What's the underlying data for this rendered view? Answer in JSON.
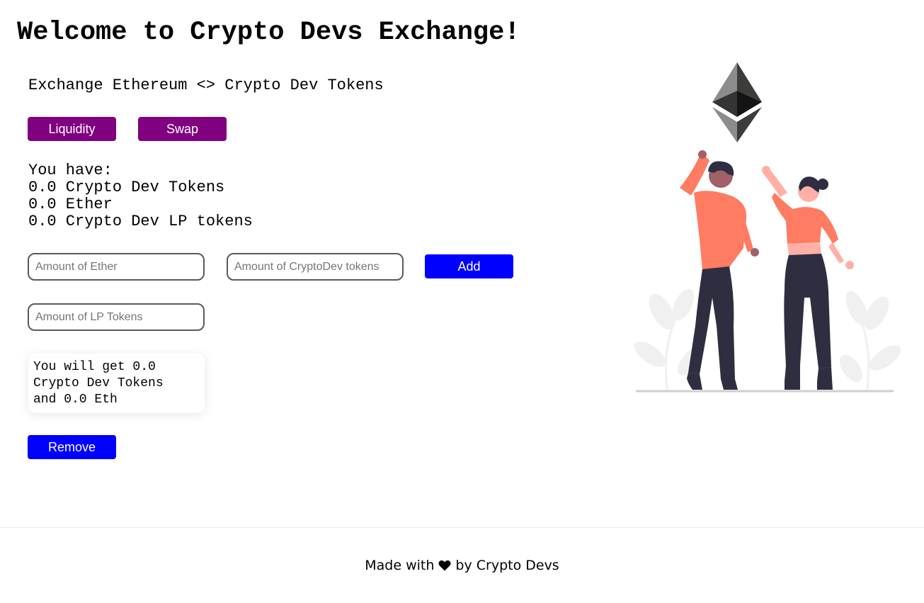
{
  "page": {
    "title": "Welcome to Crypto Devs Exchange!",
    "description": "Exchange Ethereum <> Crypto Dev Tokens"
  },
  "tabs": {
    "liquidity_label": "Liquidity",
    "swap_label": "Swap"
  },
  "balances": {
    "heading": "You have:",
    "crypto_dev_tokens": "0.0 Crypto Dev Tokens",
    "ether": "0.0 Ether",
    "lp_tokens": "0.0 Crypto Dev LP tokens"
  },
  "add_liquidity": {
    "ether_placeholder": "Amount of Ether",
    "ether_value": "",
    "cd_placeholder": "Amount of CryptoDev tokens",
    "cd_value": "",
    "add_label": "Add"
  },
  "remove_liquidity": {
    "lp_placeholder": "Amount of LP Tokens",
    "lp_value": "",
    "result_line1": "You will get 0.0",
    "result_line2": "Crypto Dev Tokens",
    "result_line3": "and 0.0 Eth",
    "remove_label": "Remove"
  },
  "footer": {
    "made_with": "Made with",
    "by": "by Crypto Devs"
  },
  "colors": {
    "tab_button": "#800080",
    "action_button": "#0000ff",
    "shirt": "#ff7b61",
    "pants": "#2f2e41"
  },
  "icons": {
    "footer_heart": "heart-icon",
    "logo": "ethereum-logo"
  }
}
